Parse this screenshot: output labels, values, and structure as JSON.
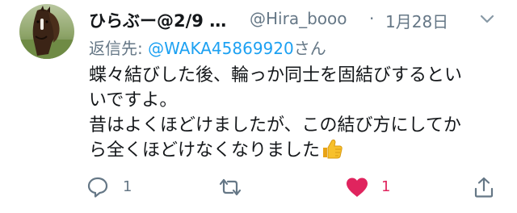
{
  "tweet": {
    "display_name": "ひらぶー@2/9 …",
    "handle": "@Hira_booo",
    "separator": "·",
    "date": "1月28日",
    "reply_prefix": "返信先: ",
    "reply_handle": "@WAKA45869920",
    "reply_suffix": "さん",
    "body_lines": [
      "蝶々結びした後、輪っか同士を固結びするとい",
      "いですよ。",
      "昔はよくほどけましたが、この結び方にしてか",
      "ら全くほどけなくなりました"
    ],
    "emoji": "thumbs-up-icon"
  },
  "actions": {
    "reply_count": "1",
    "retweet_count": "",
    "like_count": "1",
    "like_color": "#e0245e",
    "icon_color": "#657786"
  },
  "colors": {
    "link": "#1da1f2",
    "secondary": "#657786",
    "primary_text": "#14171a"
  }
}
